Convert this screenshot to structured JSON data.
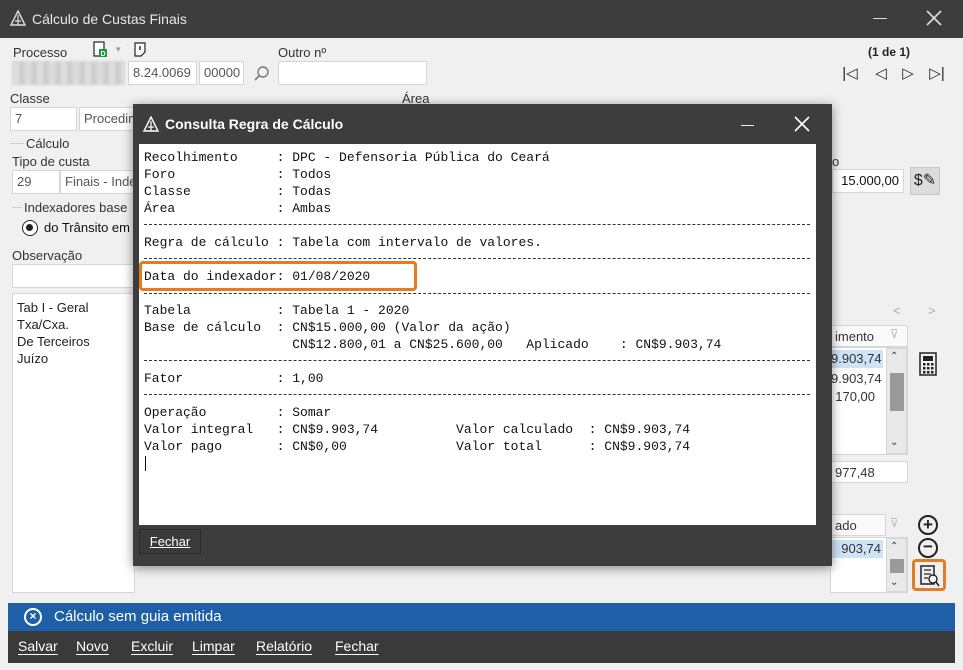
{
  "window": {
    "title": "Cálculo de Custas Finais"
  },
  "processo": {
    "label": "Processo",
    "number_mid": "8.24.0069",
    "number_end": "00000",
    "outro_label": "Outro nº",
    "outro_value": "",
    "pager": "(1 de 1)"
  },
  "classe": {
    "label": "Classe",
    "code": "7",
    "name": "Procedim"
  },
  "area": {
    "label": "Área"
  },
  "calculo": {
    "group_label": "Cálculo",
    "tipo_label": "Tipo de custa",
    "tipo_code": "29",
    "tipo_name": "Finais - Inde",
    "indexadores_label": "Indexadores base",
    "radio_label": "do Trânsito em",
    "valor_label": "o",
    "valor": "15.000,00"
  },
  "observacao": {
    "label": "Observação"
  },
  "left_list": [
    "Tab I - Geral",
    "Txa/Cxa.",
    "De Terceiros",
    "Juízo"
  ],
  "right_panel": {
    "nav_prev": "<",
    "nav_next": ">",
    "col_header": "imento",
    "values": [
      "9.903,74",
      "9.903,74",
      "170,00"
    ],
    "total": "977,48",
    "col_header2": "ado",
    "value2": "903,74"
  },
  "dialog": {
    "title": "Consulta Regra de Cálculo",
    "lines1": [
      "Recolhimento     : DPC - Defensoria Pública do Ceará",
      "Foro             : Todos",
      "Classe           : Todas",
      "Área             : Ambas"
    ],
    "regra": "Regra de cálculo : Tabela com intervalo de valores.",
    "data_indexador": "Data do indexador: 01/08/2020",
    "lines3": [
      "Tabela           : Tabela 1 - 2020",
      "Base de cálculo  : CN$15.000,00 (Valor da ação)",
      "                   CN$12.800,01 a CN$25.600,00   Aplicado    : CN$9.903,74"
    ],
    "fator": "Fator            : 1,00",
    "lines5": [
      "Operação         : Somar",
      "Valor integral   : CN$9.903,74          Valor calculado  : CN$9.903,74",
      "Valor pago       : CN$0,00              Valor total      : CN$9.903,74"
    ],
    "close_button": "Fechar"
  },
  "status": {
    "message": "Cálculo sem guia emitida"
  },
  "menu": [
    "Salvar",
    "Novo",
    "Excluir",
    "Limpar",
    "Relatório",
    "Fechar"
  ],
  "colors": {
    "accent": "#1f5fa8",
    "highlight": "#e57c23",
    "titlebar": "#3d3d3d"
  }
}
